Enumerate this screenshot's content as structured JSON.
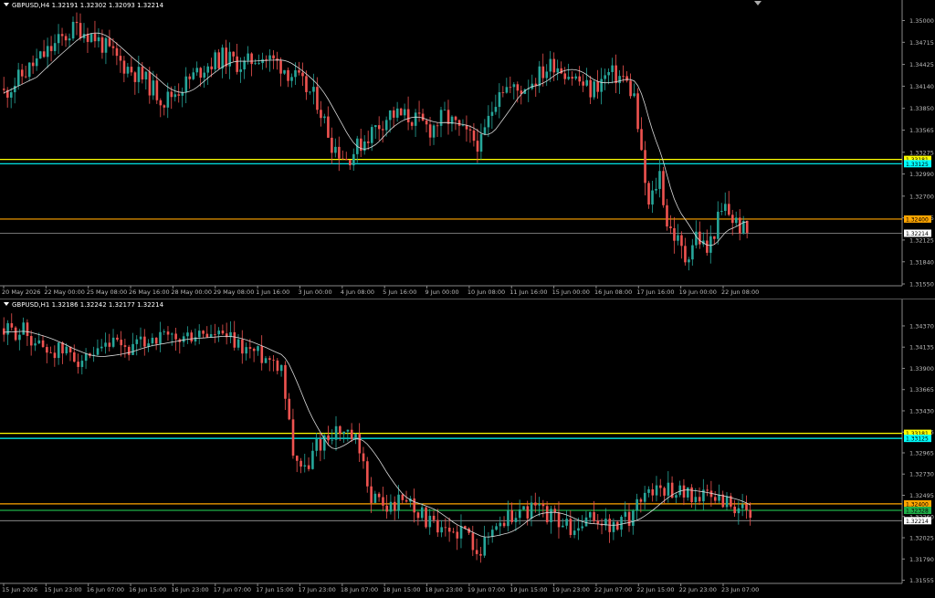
{
  "colors": {
    "background": "#000000",
    "bull": "#26a69a",
    "bear": "#ef5350",
    "ma": "#d9d9d9",
    "axis": "#bbbbbb",
    "level_yellow": "#ffff00",
    "level_cyan": "#00ffff",
    "level_orange": "#ffa500",
    "level_green": "#1fae48",
    "level_gray": "#9a9a9a"
  },
  "chart_data": [
    {
      "type": "candlestick",
      "header": "GBPUSD,H4  1.32191 1.32302 1.32093 1.32214",
      "yticks": [
        "1.35000",
        "1.34715",
        "1.34425",
        "1.34140",
        "1.33850",
        "1.33565",
        "1.33275",
        "1.32990",
        "1.32700",
        "1.32415",
        "1.32125",
        "1.31840",
        "1.31550"
      ],
      "ylim": [
        1.3155,
        1.3503
      ],
      "xticks": [
        "20 May 2026",
        "22 May 00:00",
        "25 May 08:00",
        "26 May 16:00",
        "28 May 00:00",
        "29 May 08:00",
        "1 Jun 16:00",
        "3 Jun 00:00",
        "4 Jun 08:00",
        "5 Jun 16:00",
        "9 Jun 00:00",
        "10 Jun 08:00",
        "11 Jun 16:00",
        "15 Jun 00:00",
        "16 Jun 08:00",
        "17 Jun 16:00",
        "19 Jun 00:00",
        "22 Jun 08:00"
      ],
      "anchors": [
        [
          0,
          1.3405
        ],
        [
          8,
          1.3442
        ],
        [
          15,
          1.3472
        ],
        [
          20,
          1.3492
        ],
        [
          25,
          1.3478
        ],
        [
          32,
          1.3445
        ],
        [
          38,
          1.3425
        ],
        [
          44,
          1.3395
        ],
        [
          50,
          1.3418
        ],
        [
          55,
          1.344
        ],
        [
          60,
          1.3452
        ],
        [
          66,
          1.3441
        ],
        [
          70,
          1.3455
        ],
        [
          76,
          1.3442
        ],
        [
          81,
          1.342
        ],
        [
          86,
          1.3395
        ],
        [
          90,
          1.334
        ],
        [
          94,
          1.3318
        ],
        [
          100,
          1.335
        ],
        [
          106,
          1.3378
        ],
        [
          112,
          1.3372
        ],
        [
          117,
          1.3358
        ],
        [
          121,
          1.3375
        ],
        [
          126,
          1.3352
        ],
        [
          131,
          1.3338
        ],
        [
          136,
          1.3415
        ],
        [
          141,
          1.3408
        ],
        [
          146,
          1.3425
        ],
        [
          151,
          1.3445
        ],
        [
          156,
          1.3428
        ],
        [
          161,
          1.3408
        ],
        [
          166,
          1.343
        ],
        [
          170,
          1.3425
        ],
        [
          173,
          1.34
        ],
        [
          175,
          1.332
        ],
        [
          177,
          1.3255
        ],
        [
          180,
          1.33
        ],
        [
          182,
          1.3235
        ],
        [
          185,
          1.321
        ],
        [
          187,
          1.3188
        ],
        [
          190,
          1.322
        ],
        [
          193,
          1.3198
        ],
        [
          196,
          1.3238
        ],
        [
          198,
          1.3255
        ],
        [
          200,
          1.324
        ],
        [
          204,
          1.3221
        ]
      ],
      "last_price": "1.32214",
      "levels": [
        {
          "label": "1.33181",
          "price": 1.33181,
          "color": "#ffff00"
        },
        {
          "label": "1.33125",
          "price": 1.33125,
          "color": "#00ffff"
        },
        {
          "label": "1.32400",
          "price": 1.324,
          "color": "#ffa500"
        },
        {
          "label": "1.32214",
          "price": 1.32214,
          "color": "#9a9a9a"
        }
      ]
    },
    {
      "type": "candlestick",
      "header": "GBPUSD,H1  1.32186 1.32242 1.32177 1.32214",
      "yticks": [
        "1.34370",
        "1.34135",
        "1.33900",
        "1.33665",
        "1.33430",
        "1.33195",
        "1.32965",
        "1.32730",
        "1.32495",
        "1.32260",
        "1.32025",
        "1.31790",
        "1.31555"
      ],
      "ylim": [
        1.3154,
        1.3441
      ],
      "xticks": [
        "15 Jun 2026",
        "15 Jun 23:00",
        "16 Jun 07:00",
        "16 Jun 15:00",
        "16 Jun 23:00",
        "17 Jun 07:00",
        "17 Jun 15:00",
        "17 Jun 23:00",
        "18 Jun 07:00",
        "18 Jun 15:00",
        "18 Jun 23:00",
        "19 Jun 07:00",
        "19 Jun 15:00",
        "19 Jun 23:00",
        "22 Jun 07:00",
        "22 Jun 15:00",
        "22 Jun 23:00",
        "23 Jun 07:00"
      ],
      "anchors": [
        [
          0,
          1.343
        ],
        [
          5,
          1.3432
        ],
        [
          10,
          1.3412
        ],
        [
          16,
          1.3408
        ],
        [
          22,
          1.3395
        ],
        [
          27,
          1.3415
        ],
        [
          33,
          1.341
        ],
        [
          38,
          1.3425
        ],
        [
          44,
          1.342
        ],
        [
          50,
          1.3428
        ],
        [
          56,
          1.3425
        ],
        [
          60,
          1.3415
        ],
        [
          66,
          1.3405
        ],
        [
          71,
          1.3395
        ],
        [
          74,
          1.33
        ],
        [
          77,
          1.3275
        ],
        [
          80,
          1.3305
        ],
        [
          85,
          1.3322
        ],
        [
          90,
          1.3308
        ],
        [
          94,
          1.325
        ],
        [
          98,
          1.3235
        ],
        [
          103,
          1.3248
        ],
        [
          107,
          1.3228
        ],
        [
          112,
          1.3205
        ],
        [
          117,
          1.3212
        ],
        [
          122,
          1.319
        ],
        [
          126,
          1.3218
        ],
        [
          131,
          1.323
        ],
        [
          136,
          1.3235
        ],
        [
          141,
          1.3225
        ],
        [
          146,
          1.3208
        ],
        [
          151,
          1.3225
        ],
        [
          156,
          1.3212
        ],
        [
          160,
          1.3225
        ],
        [
          164,
          1.3255
        ],
        [
          170,
          1.3258
        ],
        [
          176,
          1.325
        ],
        [
          180,
          1.3248
        ],
        [
          184,
          1.3245
        ],
        [
          188,
          1.3235
        ],
        [
          191,
          1.3221
        ]
      ],
      "last_price": "1.32214",
      "levels": [
        {
          "label": "1.33181",
          "price": 1.33181,
          "color": "#ffff00"
        },
        {
          "label": "1.33125",
          "price": 1.33125,
          "color": "#00ffff"
        },
        {
          "label": "1.32400",
          "price": 1.324,
          "color": "#ffa500"
        },
        {
          "label": "1.32328",
          "price": 1.32328,
          "color": "#1fae48"
        },
        {
          "label": "1.32214",
          "price": 1.32214,
          "color": "#9a9a9a"
        }
      ]
    }
  ]
}
